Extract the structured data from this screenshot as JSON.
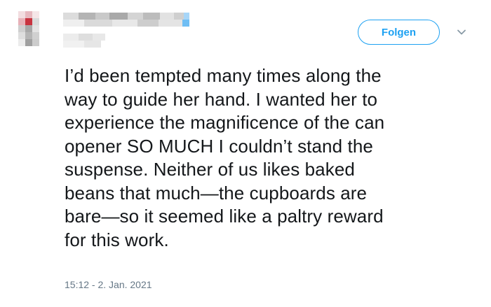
{
  "tweet": {
    "author_name": "",
    "author_handle": "",
    "follow_label": "Folgen",
    "text_lines": [
      "I’d been tempted many times along the",
      "way to guide her hand. I wanted her to",
      "experience the magnificence of the can",
      "opener SO MUCH I couldn’t stand the",
      "suspense. Neither of us likes baked",
      "beans that much—the cupboards are",
      "bare—so it seemed like a paltry reward",
      "for this work."
    ],
    "timestamp": "15:12 - 2. Jan. 2021"
  },
  "icons": {
    "menu": "chevron-down-icon",
    "avatar": "avatar-censored"
  },
  "colors": {
    "accent": "#1da1f2",
    "text": "#14171a",
    "muted": "#657786"
  }
}
